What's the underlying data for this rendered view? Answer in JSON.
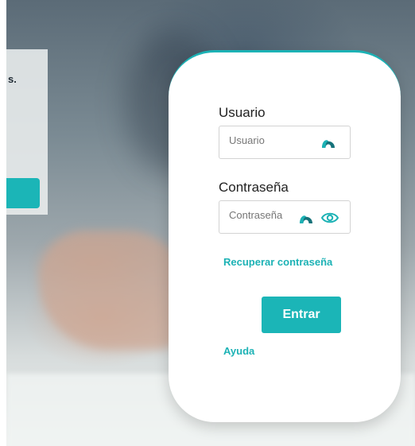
{
  "left_card": {
    "text_fragment": "s."
  },
  "login": {
    "username_label": "Usuario",
    "username_placeholder": "Usuario",
    "password_label": "Contraseña",
    "password_placeholder": "Contraseña",
    "recover_link": "Recuperar contraseña",
    "submit_label": "Entrar",
    "help_link": "Ayuda"
  },
  "icons": {
    "username_field": "arch-icon",
    "password_field": "arch-icon",
    "password_toggle": "eye-icon"
  },
  "colors": {
    "accent": "#1cb2b5",
    "card_background": "#ffffff",
    "label_text": "#222222"
  }
}
